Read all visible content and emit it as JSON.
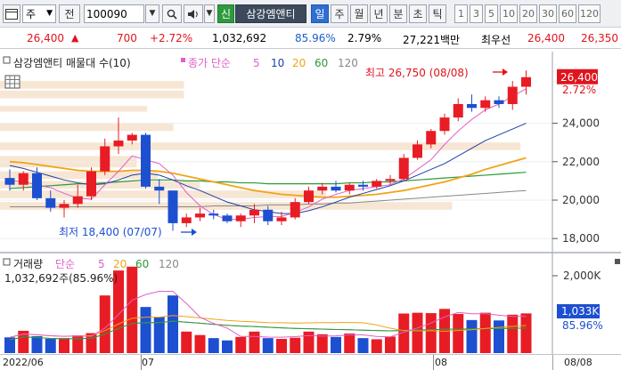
{
  "toolbar": {
    "type_label": "주",
    "jeon_label": "전",
    "code_value": "100090",
    "stock_label": "삼강엠앤티",
    "sin_label": "신",
    "period_tabs": [
      "일",
      "주",
      "월",
      "년",
      "분",
      "초",
      "틱"
    ],
    "period_numbers": [
      "1",
      "3",
      "5",
      "10",
      "20",
      "30",
      "60",
      "120"
    ],
    "selected_tab": "일"
  },
  "quote": {
    "price": "26,400",
    "change": "700",
    "change_pct": "+2.72%",
    "volume": "1,032,692",
    "volume_ratio": "85.96%",
    "turnover": "2.79%",
    "trade_value": "27,221백만",
    "best_ask_label": "최우선",
    "best_ask_price": "26,400",
    "best_bid_price": "26,350"
  },
  "price_panel": {
    "title": "삼강엠앤티 매물대 수(10)",
    "ma_label": "종가 단순",
    "ma_periods": [
      "5",
      "10",
      "20",
      "60",
      "120"
    ],
    "high_label": "최고 26,750 (08/08)",
    "low_label": "최저 18,400 (07/07)",
    "y_ticks": [
      "24,000",
      "22,000",
      "20,000",
      "18,000"
    ],
    "current_price_tag": "26,400",
    "current_pct_tag": "2.72%"
  },
  "volume_panel": {
    "title": "거래량",
    "ma_label": "단순",
    "ma_periods": [
      "5",
      "20",
      "60",
      "120"
    ],
    "volume_text": "1,032,692주(85.96%)",
    "y_tick": "2,000K",
    "current_volume_tag": "1,033K",
    "current_ratio_tag": "85.96%"
  },
  "date_axis": {
    "labels": [
      "2022/06",
      "07",
      "08"
    ],
    "right_label": "08/08"
  },
  "colors": {
    "up": "#e81c24",
    "down": "#1d4fd1",
    "ma5": "#e060c8",
    "ma10": "#1d3fa8",
    "ma20": "#f0a418",
    "ma60": "#2a9a3a",
    "ma120": "#888888",
    "volume_profile": "#f7e6d4",
    "price_tag": "#e0141e",
    "volume_tag": "#1d4fd1"
  },
  "chart_data": {
    "type": "candlestick",
    "ylim": [
      17500,
      27500
    ],
    "volume_ylim": [
      0,
      2500000
    ],
    "candles": [
      {
        "o": 21150,
        "h": 21600,
        "l": 20500,
        "c": 20800
      },
      {
        "o": 20800,
        "h": 21500,
        "l": 20500,
        "c": 21400
      },
      {
        "o": 21400,
        "h": 21700,
        "l": 20000,
        "c": 20100
      },
      {
        "o": 20100,
        "h": 20500,
        "l": 19400,
        "c": 19600
      },
      {
        "o": 19600,
        "h": 20000,
        "l": 19100,
        "c": 19800
      },
      {
        "o": 19800,
        "h": 20800,
        "l": 19600,
        "c": 20200
      },
      {
        "o": 20200,
        "h": 21700,
        "l": 20000,
        "c": 21500
      },
      {
        "o": 21500,
        "h": 23200,
        "l": 21300,
        "c": 22800
      },
      {
        "o": 22800,
        "h": 24300,
        "l": 22400,
        "c": 23100
      },
      {
        "o": 23100,
        "h": 23500,
        "l": 22900,
        "c": 23400
      },
      {
        "o": 23400,
        "h": 23500,
        "l": 20600,
        "c": 20700
      },
      {
        "o": 20700,
        "h": 21100,
        "l": 19800,
        "c": 20500
      },
      {
        "o": 20500,
        "h": 20500,
        "l": 18400,
        "c": 18800
      },
      {
        "o": 18800,
        "h": 19300,
        "l": 18600,
        "c": 19100
      },
      {
        "o": 19100,
        "h": 19600,
        "l": 18900,
        "c": 19300
      },
      {
        "o": 19300,
        "h": 19500,
        "l": 19000,
        "c": 19200
      },
      {
        "o": 19200,
        "h": 19300,
        "l": 18800,
        "c": 18900
      },
      {
        "o": 18900,
        "h": 19300,
        "l": 18600,
        "c": 19200
      },
      {
        "o": 19200,
        "h": 19800,
        "l": 18800,
        "c": 19500
      },
      {
        "o": 19500,
        "h": 19700,
        "l": 18700,
        "c": 18900
      },
      {
        "o": 18900,
        "h": 19400,
        "l": 18700,
        "c": 19100
      },
      {
        "o": 19100,
        "h": 20100,
        "l": 19000,
        "c": 19900
      },
      {
        "o": 19900,
        "h": 20700,
        "l": 19800,
        "c": 20500
      },
      {
        "o": 20500,
        "h": 20900,
        "l": 20300,
        "c": 20700
      },
      {
        "o": 20700,
        "h": 21000,
        "l": 20400,
        "c": 20500
      },
      {
        "o": 20500,
        "h": 20900,
        "l": 20300,
        "c": 20800
      },
      {
        "o": 20800,
        "h": 21000,
        "l": 20500,
        "c": 20700
      },
      {
        "o": 20700,
        "h": 21100,
        "l": 20600,
        "c": 21000
      },
      {
        "o": 21000,
        "h": 21300,
        "l": 20800,
        "c": 21100
      },
      {
        "o": 21100,
        "h": 22400,
        "l": 21000,
        "c": 22200
      },
      {
        "o": 22200,
        "h": 23100,
        "l": 22100,
        "c": 22900
      },
      {
        "o": 22900,
        "h": 23700,
        "l": 22700,
        "c": 23600
      },
      {
        "o": 23600,
        "h": 24500,
        "l": 23400,
        "c": 24300
      },
      {
        "o": 24300,
        "h": 25300,
        "l": 24100,
        "c": 25000
      },
      {
        "o": 25000,
        "h": 25500,
        "l": 24600,
        "c": 24800
      },
      {
        "o": 24800,
        "h": 25400,
        "l": 24600,
        "c": 25200
      },
      {
        "o": 25200,
        "h": 25400,
        "l": 24800,
        "c": 25000
      },
      {
        "o": 25000,
        "h": 26200,
        "l": 24700,
        "c": 25900
      },
      {
        "o": 25900,
        "h": 26750,
        "l": 25500,
        "c": 26400
      }
    ],
    "volume": [
      410000,
      580000,
      440000,
      370000,
      390000,
      460000,
      520000,
      1500000,
      2150000,
      2250000,
      1200000,
      940000,
      1500000,
      560000,
      470000,
      390000,
      330000,
      420000,
      560000,
      390000,
      370000,
      400000,
      560000,
      490000,
      420000,
      510000,
      390000,
      360000,
      430000,
      1030000,
      1050000,
      1040000,
      1150000,
      1020000,
      860000,
      1050000,
      850000,
      1000000,
      1033000
    ],
    "ma": {
      "5": [
        21050,
        20950,
        20800,
        20650,
        20350,
        20100,
        20050,
        20800,
        21500,
        22300,
        22100,
        21900,
        21300,
        20400,
        19700,
        19250,
        19000,
        19000,
        19100,
        19150,
        19150,
        19350,
        19650,
        20050,
        20300,
        20500,
        20600,
        20700,
        20800,
        21100,
        21600,
        22100,
        22900,
        23600,
        24200,
        24700,
        25000,
        25400,
        25800
      ],
      "10": [
        21800,
        21650,
        21450,
        21250,
        21050,
        20900,
        20800,
        20850,
        21050,
        21300,
        21400,
        21300,
        21050,
        20750,
        20500,
        20200,
        19900,
        19700,
        19500,
        19400,
        19300,
        19300,
        19450,
        19650,
        19900,
        20150,
        20350,
        20550,
        20750,
        21000,
        21300,
        21600,
        21900,
        22300,
        22700,
        23100,
        23400,
        23700,
        24000
      ],
      "20": [
        22000,
        21950,
        21850,
        21750,
        21650,
        21550,
        21500,
        21500,
        21500,
        21550,
        21550,
        21500,
        21400,
        21250,
        21100,
        20950,
        20800,
        20650,
        20500,
        20400,
        20300,
        20250,
        20200,
        20150,
        20150,
        20200,
        20250,
        20300,
        20400,
        20500,
        20650,
        20800,
        20950,
        21150,
        21350,
        21600,
        21800,
        22000,
        22200
      ],
      "60": [
        20600,
        20650,
        20700,
        20750,
        20800,
        20850,
        20850,
        20900,
        20950,
        21000,
        21050,
        21050,
        21050,
        21000,
        21000,
        20950,
        20950,
        20900,
        20900,
        20850,
        20850,
        20850,
        20850,
        20850,
        20850,
        20900,
        20900,
        20950,
        20950,
        21000,
        21050,
        21100,
        21150,
        21200,
        21250,
        21300,
        21350,
        21400,
        21450
      ],
      "120": [
        19650,
        19650,
        19650,
        19650,
        19650,
        19650,
        19650,
        19650,
        19650,
        19650,
        19650,
        19650,
        19650,
        19650,
        19650,
        19700,
        19700,
        19700,
        19700,
        19750,
        19750,
        19750,
        19800,
        19800,
        19850,
        19850,
        19900,
        19950,
        20000,
        20050,
        20100,
        20150,
        20200,
        20250,
        20300,
        20350,
        20400,
        20450,
        20500
      ]
    },
    "volume_profile": [
      {
        "lo": 19500,
        "hi": 19900,
        "frac": 0.86
      },
      {
        "lo": 20100,
        "hi": 20500,
        "frac": 0.62
      },
      {
        "lo": 20600,
        "hi": 21000,
        "frac": 0.38
      },
      {
        "lo": 21100,
        "hi": 21500,
        "frac": 0.3
      },
      {
        "lo": 21700,
        "hi": 22300,
        "frac": 0.26
      },
      {
        "lo": 22600,
        "hi": 23000,
        "frac": 0.99
      },
      {
        "lo": 23600,
        "hi": 24000,
        "frac": 0.33
      },
      {
        "lo": 24600,
        "hi": 24900,
        "frac": 0.28
      },
      {
        "lo": 25300,
        "hi": 25700,
        "frac": 0.35
      },
      {
        "lo": 25800,
        "hi": 26200,
        "frac": 0.35
      }
    ]
  }
}
